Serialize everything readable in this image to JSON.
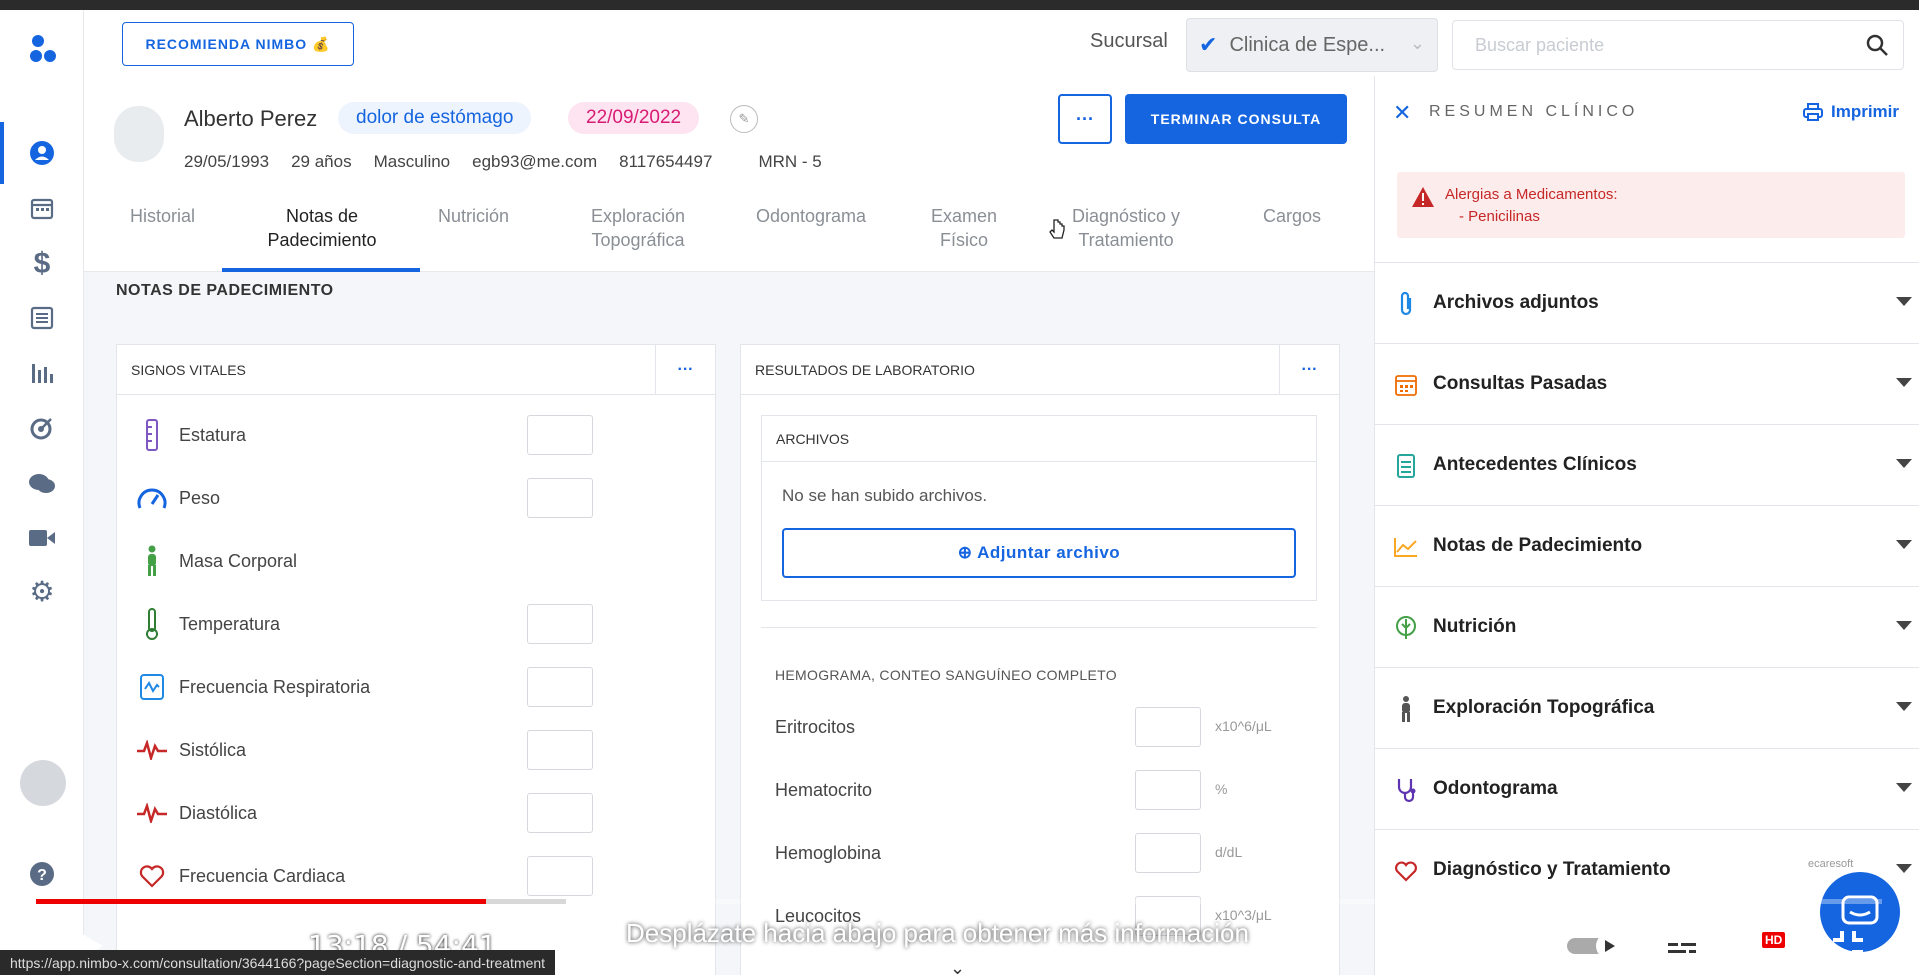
{
  "header": {
    "recommend_label": "RECOMIENDA NIMBO 💰",
    "sucursal_label": "Sucursal",
    "branch_value": "Clinica de Espe...",
    "search_placeholder": "Buscar paciente"
  },
  "patient": {
    "name": "Alberto Perez",
    "reason": "dolor de estómago",
    "date": "22/09/2022",
    "birthdate": "29/05/1993",
    "age": "29 años",
    "sex": "Masculino",
    "email": "egb93@me.com",
    "phone": "8117654497",
    "mrn": "MRN - 5",
    "more_label": "···",
    "finish_label": "TERMINAR CONSULTA"
  },
  "tabs": [
    {
      "label": "Historial"
    },
    {
      "label": "Notas de\nPadecimiento"
    },
    {
      "label": "Nutrición"
    },
    {
      "label": "Exploración\nTopográfica"
    },
    {
      "label": "Odontograma"
    },
    {
      "label": "Examen\nFísico"
    },
    {
      "label": "Diagnóstico y\nTratamiento"
    },
    {
      "label": "Cargos"
    }
  ],
  "main": {
    "section_title": "NOTAS DE PADECIMIENTO",
    "vitals_title": "SIGNOS VITALES",
    "lab_title": "RESULTADOS DE LABORATORIO",
    "dots": "···",
    "vitals": [
      {
        "label": "Estatura",
        "icon": "ruler-icon",
        "color": "#7e57c2"
      },
      {
        "label": "Peso",
        "icon": "gauge-icon",
        "color": "#1565e0"
      },
      {
        "label": "Masa Corporal",
        "icon": "body-icon",
        "color": "#43a047"
      },
      {
        "label": "Temperatura",
        "icon": "thermometer-icon",
        "color": "#2e7d32"
      },
      {
        "label": "Frecuencia Respiratoria",
        "icon": "lungs-icon",
        "color": "#1e88e5"
      },
      {
        "label": "Sistólica",
        "icon": "pulse-icon",
        "color": "#c62828"
      },
      {
        "label": "Diastólica",
        "icon": "pulse-icon",
        "color": "#c62828"
      },
      {
        "label": "Frecuencia Cardiaca",
        "icon": "heart-icon",
        "color": "#c62828"
      }
    ],
    "files_title": "ARCHIVOS",
    "no_files": "No se han subido archivos.",
    "attach_label": "⊕ Adjuntar archivo",
    "hemo_title": "HEMOGRAMA, CONTEO SANGUÍNEO COMPLETO",
    "labs": [
      {
        "label": "Eritrocitos",
        "unit": "x10^6/μL"
      },
      {
        "label": "Hematocrito",
        "unit": "%"
      },
      {
        "label": "Hemoglobina",
        "unit": "d/dL"
      },
      {
        "label": "Leucocitos",
        "unit": "x10^3/μL"
      }
    ]
  },
  "summary": {
    "title": "RESUMEN CLÍNICO",
    "print_label": "Imprimir",
    "allergy_title": "Alergias a Medicamentos:",
    "allergy_item": "- Penicilinas",
    "sections": [
      {
        "label": "Archivos adjuntos",
        "icon": "paperclip-icon",
        "color": "#1e88e5"
      },
      {
        "label": "Consultas Pasadas",
        "icon": "calendar-icon",
        "color": "#ef6c00"
      },
      {
        "label": "Antecedentes Clínicos",
        "icon": "document-icon",
        "color": "#26a69a"
      },
      {
        "label": "Notas de Padecimiento",
        "icon": "chart-line-icon",
        "color": "#f9a825"
      },
      {
        "label": "Nutrición",
        "icon": "leaf-icon",
        "color": "#43a047"
      },
      {
        "label": "Exploración Topográfica",
        "icon": "body-icon",
        "color": "#555555"
      },
      {
        "label": "Odontograma",
        "icon": "stethoscope-icon",
        "color": "#5e35b1"
      },
      {
        "label": "Diagnóstico y Tratamiento",
        "icon": "heart-icon",
        "color": "#c62828"
      }
    ],
    "brand": "ecaresoft"
  },
  "video": {
    "time": "13:18 / 54:41",
    "caption": "Desplázate hacia abajo para obtener más información",
    "url": "https://app.nimbo-x.com/consultation/3644166?pageSection=diagnostic-and-treatment",
    "progress_fraction": 0.244,
    "hd_badge": "HD"
  },
  "colors": {
    "primary": "#1565e0",
    "date_pink": "#d81b74",
    "allergy_red": "#c62828"
  }
}
